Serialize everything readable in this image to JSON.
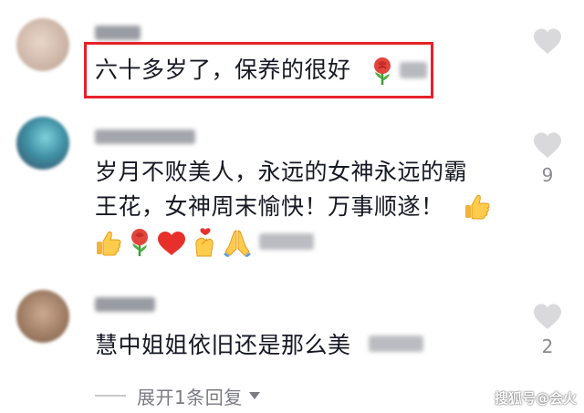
{
  "comments": [
    {
      "text_lines": [
        "六十多岁了，保养的很好"
      ],
      "emojis": [
        "rose"
      ],
      "likes": "",
      "highlighted": true
    },
    {
      "text_lines": [
        "岁月不败美人，永远的女神永远的霸",
        "王花，女神周末愉快！万事顺遂！"
      ],
      "emojis": [
        "thumbs-up",
        "thumbs-up",
        "rose",
        "heart",
        "finger-heart",
        "folded-hands"
      ],
      "likes": "9",
      "highlighted": false
    },
    {
      "text_lines": [
        "慧中姐姐依旧还是那么美"
      ],
      "emojis": [],
      "likes": "2",
      "highlighted": false
    }
  ],
  "expand_replies": {
    "label": "展开1条回复"
  },
  "watermark": "搜狐号@会火",
  "colors": {
    "highlight": "#e6212b",
    "heart": "#d9d9dc",
    "secondary_text": "#7b7c82"
  }
}
